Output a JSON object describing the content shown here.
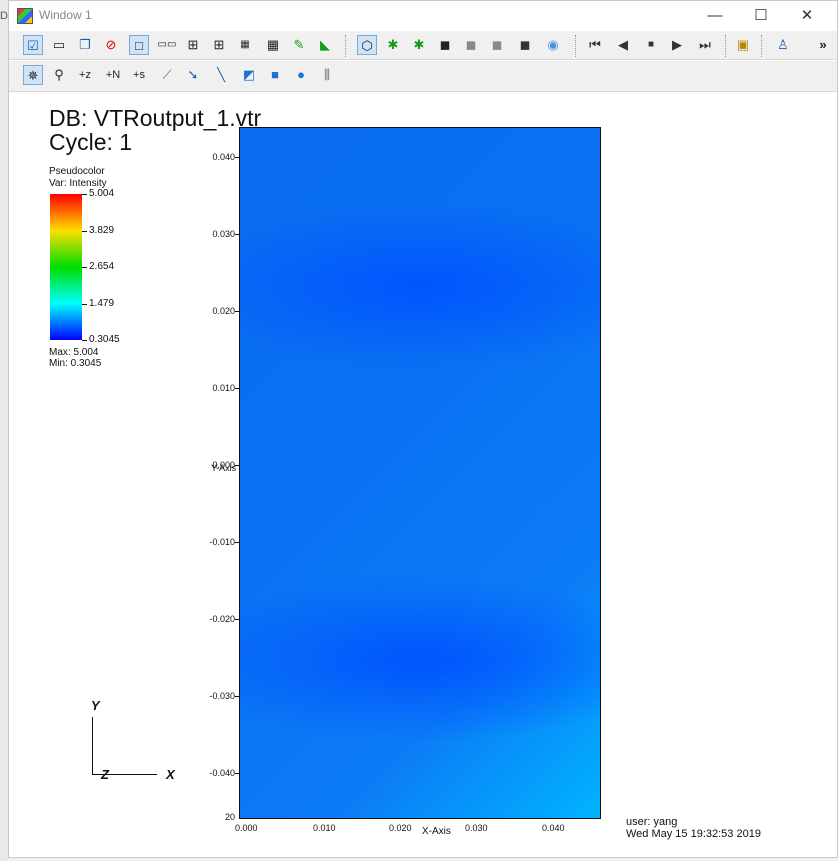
{
  "window": {
    "title": "Window 1",
    "edge_letter": "D"
  },
  "window_controls": {
    "minimize": "—",
    "maximize": "☐",
    "close": "✕"
  },
  "toolbar1": {
    "icons": [
      "active-window-icon",
      "new-window-icon",
      "clone-window-icon",
      "delete-window-icon",
      "layout-1x1-icon",
      "layout-1x2-icon",
      "layout-2x2-icon",
      "layout-2x3-icon",
      "layout-2x4-icon",
      "layout-3x3-icon",
      "lock-view-icon",
      "lock-time-icon",
      "navigate-mode-icon",
      "camera-1-icon",
      "camera-2-icon",
      "camera-3-icon",
      "camera-4-icon",
      "camera-5-icon",
      "camera-6-icon",
      "spin-icon",
      "reverse-step-icon",
      "reverse-play-icon",
      "stop-icon",
      "play-icon",
      "forward-step-icon",
      "palette-icon",
      "rendering-icon"
    ],
    "overflow": "»"
  },
  "toolbar2": {
    "icons": [
      "navigate-icon",
      "zoom-icon",
      "plus-z-icon",
      "plus-n-icon",
      "plus-s-icon",
      "curve-icon",
      "pick-icon",
      "line-icon",
      "plane-icon",
      "box-icon",
      "sphere-icon",
      "sliders-icon"
    ],
    "labels": {
      "plus_z": "+z",
      "plus_n": "+N",
      "plus_s": "+s"
    }
  },
  "viewport": {
    "db_title": "DB: VTRoutput_1.vtr",
    "cycle": "Cycle: 1",
    "legend": {
      "plot_type": "Pseudocolor",
      "var": "Var: Intensity",
      "ticks": [
        "5.004",
        "3.829",
        "2.654",
        "1.479",
        "0.3045"
      ],
      "max": "Max:  5.004",
      "min": "Min:  0.3045"
    },
    "y_ticks": [
      "0.040",
      "0.030",
      "0.020",
      "0.010",
      "0.000",
      "-0.010",
      "-0.020",
      "-0.030",
      "-0.040"
    ],
    "x_ticks": [
      "0.000",
      "0.010",
      "0.020",
      "0.030",
      "0.040"
    ],
    "x_label": "X-Axis",
    "y_label": "Y-Axis",
    "y_bottom_partial": "20",
    "triad": {
      "y": "Y",
      "z": "Z",
      "x": "X"
    },
    "user": "user: yang",
    "timestamp": "Wed May 15 19:32:53 2019"
  }
}
